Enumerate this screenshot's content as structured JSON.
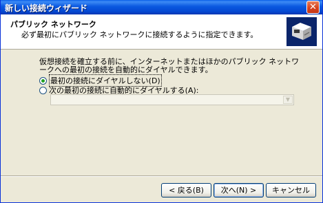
{
  "window": {
    "title": "新しい接続ウィザード",
    "close_glyph": "✕"
  },
  "header": {
    "title": "パブリック ネットワーク",
    "subtitle": "必ず最初にパブリック ネットワークに接続するように指定できます。",
    "icon": "network-connection-icon"
  },
  "main": {
    "description": "仮想接続を確立する前に、インターネットまたはほかのパブリック ネットワークへの最初の接続を自動的にダイヤルできます。",
    "options": [
      {
        "label": "最初の接続にダイヤルしない(D)",
        "checked": true
      },
      {
        "label": "次の最初の接続に自動的にダイヤルする(A):",
        "checked": false
      }
    ],
    "dropdown": {
      "value": "",
      "disabled": true
    }
  },
  "buttons": {
    "back": "< 戻る(B)",
    "next": "次へ(N) >",
    "cancel": "キャンセル"
  }
}
